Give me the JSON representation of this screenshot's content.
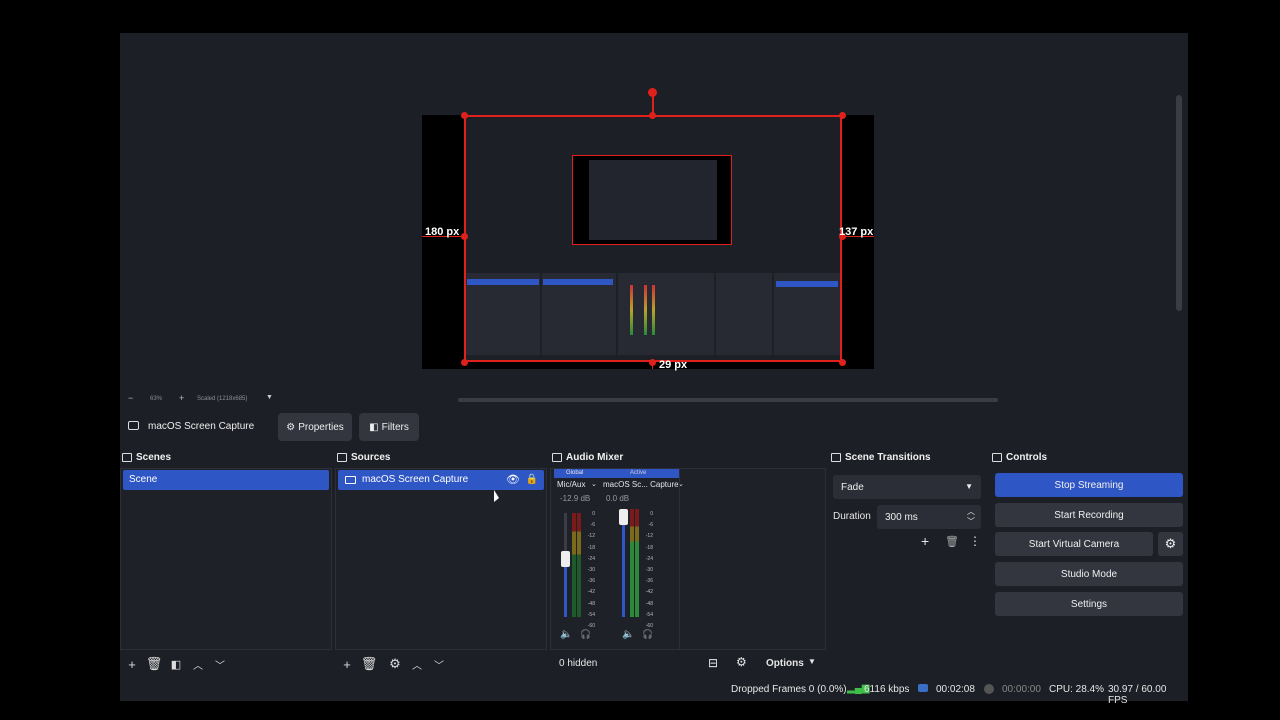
{
  "preview": {
    "zoom": "63%",
    "scale_label": "Scaled (1218x685)",
    "left_crop": "180 px",
    "right_crop": "137 px",
    "bottom_crop": "29 px"
  },
  "context": {
    "source_name": "macOS Screen Capture",
    "properties_label": "Properties",
    "filters_label": "Filters"
  },
  "scenes": {
    "title": "Scenes",
    "items": [
      {
        "label": "Scene"
      }
    ]
  },
  "sources": {
    "title": "Sources",
    "items": [
      {
        "label": "macOS Screen Capture"
      }
    ]
  },
  "audio_mixer": {
    "title": "Audio Mixer",
    "tabs": [
      "Global",
      "Active"
    ],
    "channels": [
      {
        "name": "Mic/Aux",
        "db": "-12.9 dB",
        "level": 0.4
      },
      {
        "name": "macOS Sc... Capture",
        "db": "0.0 dB",
        "level": 1.0
      }
    ],
    "scale": [
      "0",
      "-6",
      "-12",
      "-18",
      "-24",
      "-30",
      "-36",
      "-42",
      "-48",
      "-54",
      "-60"
    ],
    "hidden_label": "0 hidden",
    "options_label": "Options"
  },
  "scene_transitions": {
    "title": "Scene Transitions",
    "transition": "Fade",
    "duration_label": "Duration",
    "duration_value": "300 ms"
  },
  "controls": {
    "title": "Controls",
    "stop_streaming": "Stop Streaming",
    "start_recording": "Start Recording",
    "start_virtual_camera": "Start Virtual Camera",
    "studio_mode": "Studio Mode",
    "settings": "Settings"
  },
  "status": {
    "dropped_frames": "Dropped Frames 0 (0.0%)",
    "bitrate": "6116 kbps",
    "stream_time": "00:02:08",
    "record_time": "00:00:00",
    "cpu": "CPU: 28.4%",
    "fps": "30.97 / 60.00 FPS"
  },
  "colors": {
    "accent": "#2f56c5",
    "selection_red": "#e0201b",
    "bitrate_green": "#3fbf4a"
  }
}
